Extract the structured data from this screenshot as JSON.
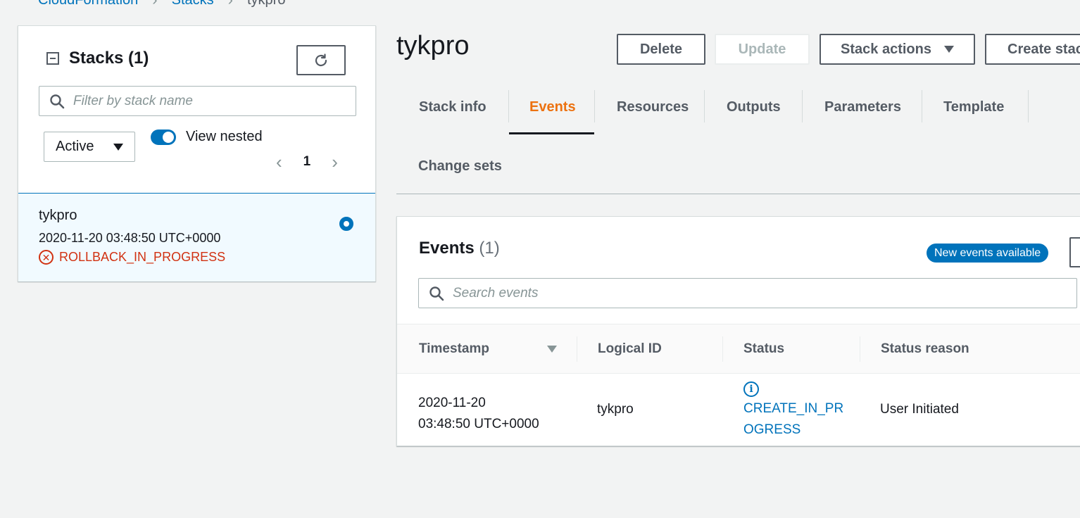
{
  "breadcrumb": {
    "root": "CloudFormation",
    "section": "Stacks",
    "current": "tykpro"
  },
  "left_panel": {
    "title": "Stacks (1)",
    "filter_placeholder": "Filter by stack name",
    "status_filter": "Active",
    "view_nested_label": "View nested",
    "view_nested_on": true,
    "page_number": "1",
    "stack": {
      "name": "tykpro",
      "created": "2020-11-20 03:48:50 UTC+0000",
      "status": "ROLLBACK_IN_PROGRESS",
      "selected": true
    }
  },
  "header": {
    "title": "tykpro",
    "buttons": {
      "delete": "Delete",
      "update": "Update",
      "stack_actions": "Stack actions",
      "create": "Create stack"
    }
  },
  "tabs": [
    "Stack info",
    "Events",
    "Resources",
    "Outputs",
    "Parameters",
    "Template",
    "Change sets"
  ],
  "active_tab": "Events",
  "events": {
    "title": "Events",
    "count": "(1)",
    "new_badge": "New events available",
    "search_placeholder": "Search events",
    "columns": [
      "Timestamp",
      "Logical ID",
      "Status",
      "Status reason"
    ],
    "rows": [
      {
        "timestamp_line1": "2020-11-20",
        "timestamp_line2": "03:48:50 UTC+0000",
        "logical_id": "tykpro",
        "status_line1": "CREATE_IN_PR",
        "status_line2": "OGRESS",
        "reason": "User Initiated"
      }
    ]
  },
  "colors": {
    "accent": "#0073bb",
    "active_tab": "#ec7211",
    "error": "#d13212",
    "background": "#f2f3f3"
  }
}
